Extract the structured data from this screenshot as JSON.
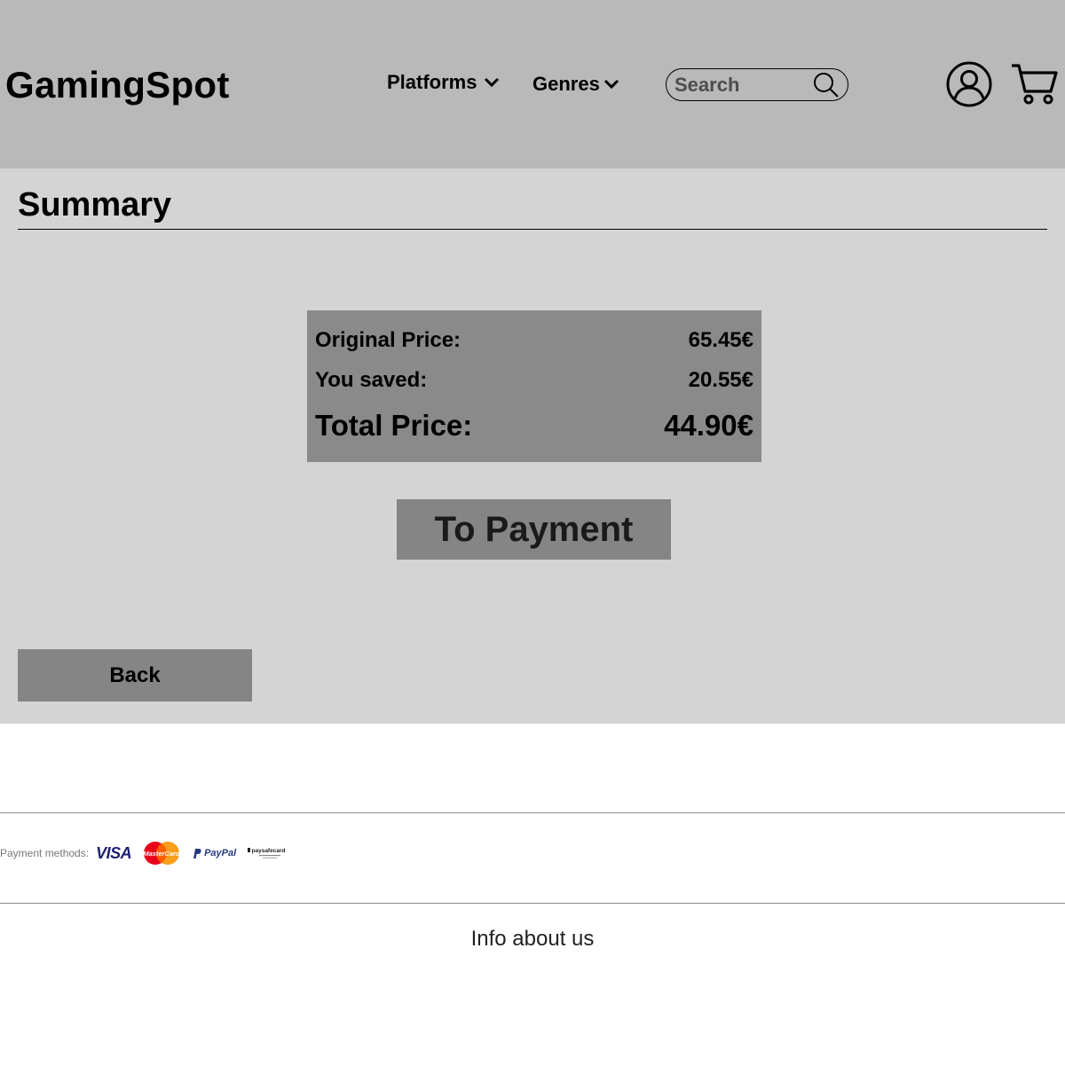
{
  "header": {
    "logo": "GamingSpot",
    "nav": [
      {
        "label": "Platforms"
      },
      {
        "label": "Genres"
      }
    ],
    "search": {
      "placeholder": "Search",
      "value": ""
    }
  },
  "main": {
    "title": "Summary",
    "summary": {
      "original_label": "Original Price:",
      "original_value": "65.45€",
      "saved_label": "You saved:",
      "saved_value": "20.55€",
      "total_label": "Total Price:",
      "total_value": "44.90€"
    },
    "pay_button": "To Payment",
    "back_button": "Back"
  },
  "footer": {
    "payment_label": "Payment methods:",
    "methods": [
      {
        "name": "VISA",
        "icon": "visa-logo"
      },
      {
        "name": "MasterCard",
        "icon": "mastercard-logo"
      },
      {
        "name": "PayPal",
        "icon": "paypal-logo"
      },
      {
        "name": "paysafecard",
        "icon": "paysafecard-logo"
      }
    ],
    "info": "Info about us"
  },
  "colors": {
    "header_bg": "#b9b9b9",
    "main_bg": "#d4d4d4",
    "price_box_bg": "#8a8a8a",
    "button_bg": "#858585"
  }
}
